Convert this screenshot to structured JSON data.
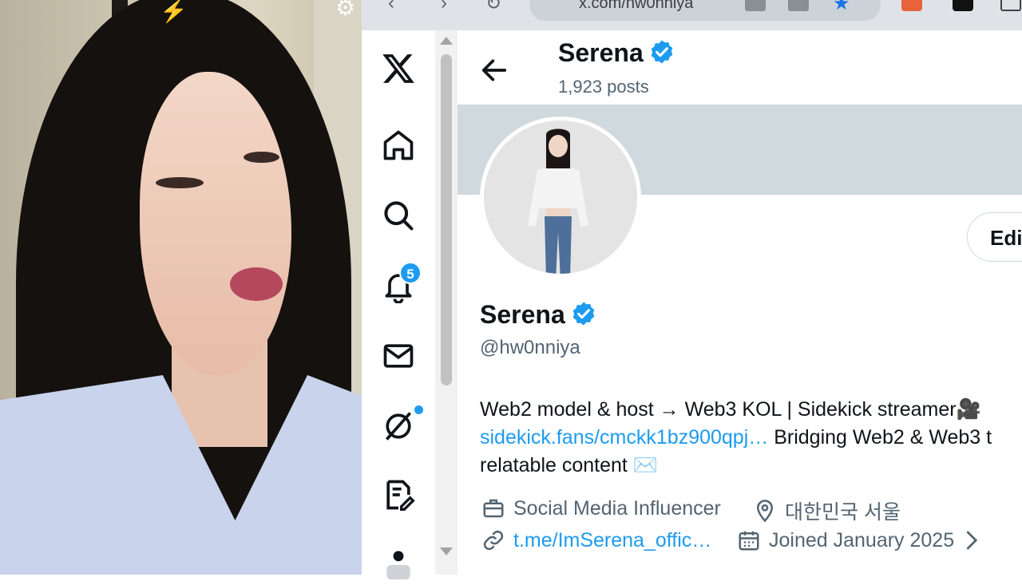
{
  "browser": {
    "url": "x.com/hw0nniya",
    "accent": "#1d9bf0"
  },
  "nav": {
    "items": [
      "x-logo",
      "home-icon",
      "search-icon",
      "notifications-icon",
      "messages-icon",
      "grok-icon",
      "drafts-icon"
    ],
    "notifications_count": "5"
  },
  "profile": {
    "header_name": "Serena",
    "post_count": "1,923 posts",
    "name": "Serena",
    "handle": "@hw0nniya",
    "edit_label": "Edi",
    "bio_line1": "Web2 model & host → Web3 KOL | Sidekick streamer🎥",
    "bio_link": "sidekick.fans/cmckk1bz900qpj…",
    "bio_line2_rest": " Bridging Web2 & Web3 t",
    "bio_line3": "relatable content ✉️",
    "profession": "Social Media Influencer",
    "location": "대한민국 서울",
    "website": "t.me/ImSerena_offic…",
    "joined": "Joined January 2025"
  }
}
